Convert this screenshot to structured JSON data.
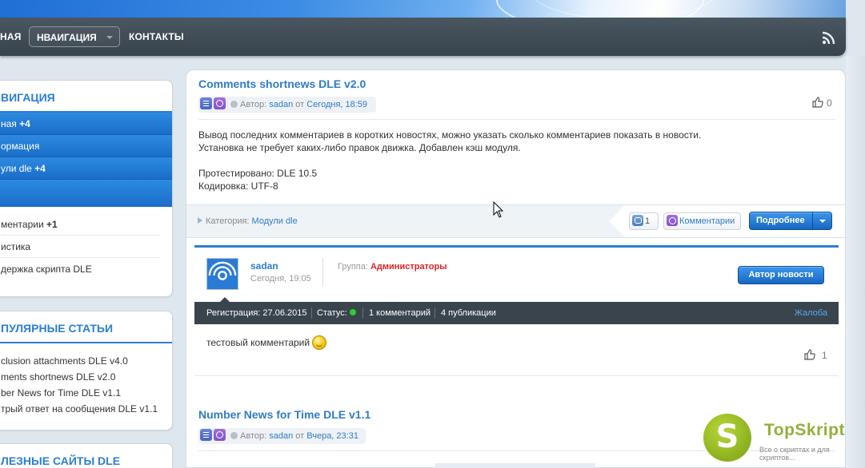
{
  "nav": {
    "home": "НАЯ",
    "navigation": "НВАИГАЦИЯ",
    "contacts": "КОНТАКТЫ"
  },
  "sidebar": {
    "nav_block": {
      "title": "ВИГАЦИЯ",
      "items": [
        {
          "label": "ная",
          "badge": "+4"
        },
        {
          "label": "ормация",
          "badge": ""
        },
        {
          "label": "ули dle",
          "badge": "+4"
        }
      ],
      "plain_items": [
        {
          "label": "ментарии",
          "badge": "+1"
        },
        {
          "label": "истика",
          "badge": ""
        },
        {
          "label": "держка скрипта DLE",
          "badge": ""
        }
      ]
    },
    "popular": {
      "title": "ПУЛЯРНЫЕ СТАТЬИ",
      "items": [
        "clusion attachments DLE v4.0",
        "ments shortnews DLE v2.0",
        "ber News for Time DLE v1.1",
        "трый ответ на сообщения DLE v1.1"
      ]
    },
    "useful": {
      "title": "ЛЕЗНЫЕ САЙТЫ DLE"
    }
  },
  "post1": {
    "title": "Comments shortnews DLE v2.0",
    "author_label": "Автор:",
    "author": "sadan",
    "from": "от",
    "date": "Сегодня, 18:59",
    "likes": "0",
    "text": [
      "Вывод последних комментариев в коротких новостях, можно указать сколько комментариев показать в новости.",
      "Установка не требует каких-либо правок движка. Добавлен кэш модуля.",
      "",
      "Протестировано: DLE 10.5",
      "Кодировка: UTF-8"
    ],
    "category_label": "Категория:",
    "category": "Модули dle",
    "comments_count": "1",
    "comments_btn": "Комментарии",
    "more_btn": "Подробнее"
  },
  "comment": {
    "user": "sadan",
    "date": "Сегодня, 19:05",
    "group_label": "Группа:",
    "group": "Администраторы",
    "author_btn": "Автор новости",
    "registration": "Регистрация: 27.06.2015",
    "status": "Статус:",
    "comments": "1 комментарий",
    "publications": "4 публикации",
    "complaint": "Жалоба",
    "text": "тестовый комментарий",
    "likes": "1"
  },
  "post2": {
    "title": "Number News for Time DLE v1.1",
    "author_label": "Автор:",
    "author": "sadan",
    "from": "от",
    "date": "Вчера, 23:31"
  },
  "watermark": {
    "letter": "S",
    "name": "TopSkript",
    "tagline": "Все о скриптах и для скриптов..."
  },
  "colors": {
    "accent": "#2b7fd3",
    "nav_bg": "#3f4a53",
    "admin_red": "#e02222",
    "status_online": "#2ecc2e"
  }
}
